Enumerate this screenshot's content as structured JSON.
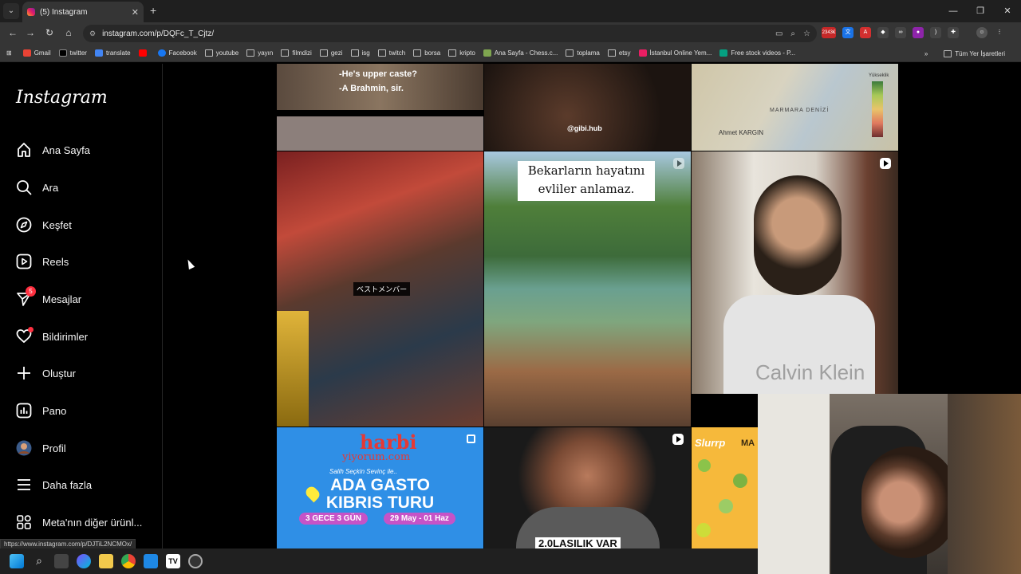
{
  "browser": {
    "tab_title": "(5) Instagram",
    "address": "instagram.com/p/DQFc_T_Cjtz/",
    "status_url": "https://www.instagram.com/p/DJTiL2NCMOx/",
    "bookmarks": [
      "Gmail",
      "twitter",
      "translate",
      "",
      "Facebook",
      "youtube",
      "yayın",
      "filmdizi",
      "gezi",
      "isg",
      "twitch",
      "borsa",
      "kripto",
      "Ana Sayfa - Chess.c...",
      "toplama",
      "etsy",
      "İstanbul Online Yem...",
      "Free stock videos - P..."
    ],
    "all_bookmarks": "Tüm Yer İşaretleri",
    "ext_badge": "2343€"
  },
  "sidebar": {
    "logo": "Instagram",
    "items": [
      {
        "label": "Ana Sayfa",
        "icon": "home-icon"
      },
      {
        "label": "Ara",
        "icon": "search-icon"
      },
      {
        "label": "Keşfet",
        "icon": "compass-icon"
      },
      {
        "label": "Reels",
        "icon": "reels-icon"
      },
      {
        "label": "Mesajlar",
        "icon": "messenger-icon",
        "badge": "5"
      },
      {
        "label": "Bildirimler",
        "icon": "heart-icon"
      },
      {
        "label": "Oluştur",
        "icon": "plus-icon"
      },
      {
        "label": "Pano",
        "icon": "dashboard-icon"
      },
      {
        "label": "Profil",
        "icon": "avatar-icon"
      },
      {
        "label": "Daha fazla",
        "icon": "menu-icon"
      },
      {
        "label": "Meta'nın diğer ürünl...",
        "icon": "meta-apps-icon"
      }
    ]
  },
  "grid": {
    "t1_line1": "-He's upper caste?",
    "t1_line2": "-A Brahmin, sir.",
    "t2_handle": "@gibi.hub",
    "t3_map_label": "MARMARA DENİZİ",
    "t3_author": "Ahmet KARGIN",
    "t3_legend": "Yükseklik",
    "t4_caption": "ベストメンバー",
    "t5_caption_line1": "Bekarların hayatını",
    "t5_caption_line2": "evliler anlamaz.",
    "t6_text": "Calvin Klein",
    "t7_brand": "harbi",
    "t7_brand2": "yiyorum.com",
    "t7_sub": "Salih Seçkin Sevinç ile..",
    "t7_title1": "ADA GASTO",
    "t7_title2": "KIBRIS TURU",
    "t7_pill1": "3 GECE 3 GÜN",
    "t7_pill2": "29 May - 01 Haz",
    "t8_caption": "2.0LASILIK VAR",
    "t9_brand": "Slurrp",
    "t9_title": "MA"
  },
  "colors": {
    "badge": "#ff3040",
    "harbi_bg": "#1e88e5",
    "harbi_title": "#ffeb3b"
  }
}
